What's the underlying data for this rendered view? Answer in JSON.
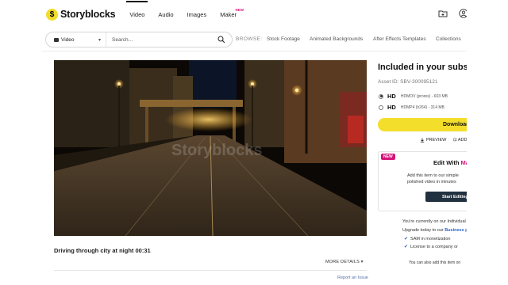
{
  "brand": {
    "name": "Storyblocks"
  },
  "nav": {
    "items": [
      {
        "label": "Video"
      },
      {
        "label": "Audio"
      },
      {
        "label": "Images"
      },
      {
        "label": "Maker",
        "badge": "NEW"
      }
    ],
    "icons": [
      "folder-icon",
      "user-icon"
    ]
  },
  "search": {
    "type_label": "Video",
    "placeholder": "Search...",
    "browse_label": "BROWSE:",
    "browse_links": [
      "Stock Footage",
      "Animated Backgrounds",
      "After Effects Templates",
      "Collections"
    ]
  },
  "video": {
    "title": "Driving through city at night 00:31",
    "watermark": "Storyblocks",
    "more_details": "MORE DETAILS",
    "report": "Report an Issue"
  },
  "panel": {
    "title": "Included in your subscription",
    "asset_id": "Asset ID: SBV-300095121",
    "formats": [
      {
        "label": "HD",
        "desc": "HDMOV (prores) - 603 MB",
        "selected": true
      },
      {
        "label": "HD",
        "desc": "HDMP4 (h264) - 314 MB",
        "selected": false
      }
    ],
    "download": "Download",
    "preview": "PREVIEW",
    "add": "ADD",
    "maker": {
      "new_tag": "NEW",
      "title_prefix": "Edit With ",
      "title_brand": "Maker",
      "line1": "Add this item to our simple",
      "line2": "polished video in minutes",
      "start": "Start Editing"
    },
    "plan": {
      "line1": "You're currently on our Individual plan",
      "line2_prefix": "Upgrade today to our ",
      "line2_link": "Business plan",
      "checks": [
        "SAM in monetization",
        "License to a company or"
      ],
      "note": "You can also add this item on"
    }
  },
  "colors": {
    "accent": "#f3de2b",
    "maker": "#d6147a",
    "link": "#2a66c6"
  }
}
